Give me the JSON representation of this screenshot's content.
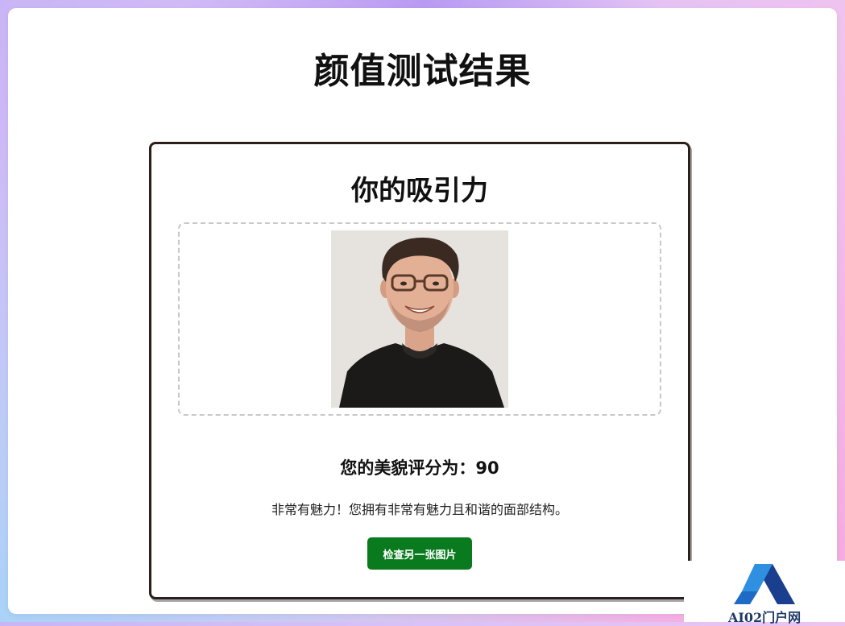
{
  "page": {
    "title": "颜值测试结果"
  },
  "card": {
    "title": "你的吸引力",
    "photo_alt": "上传的人像照片",
    "score_label": "您的美貌评分为：",
    "score_value": "90",
    "description": "非常有魅力！您拥有非常有魅力且和谐的面部结构。",
    "retry_button": "检查另一张图片"
  },
  "watermark": {
    "text": "AI02门户网"
  },
  "colors": {
    "button_bg": "#0a7a1f",
    "card_border": "#2a1f1c",
    "dashed_border": "#c8c8c8"
  }
}
